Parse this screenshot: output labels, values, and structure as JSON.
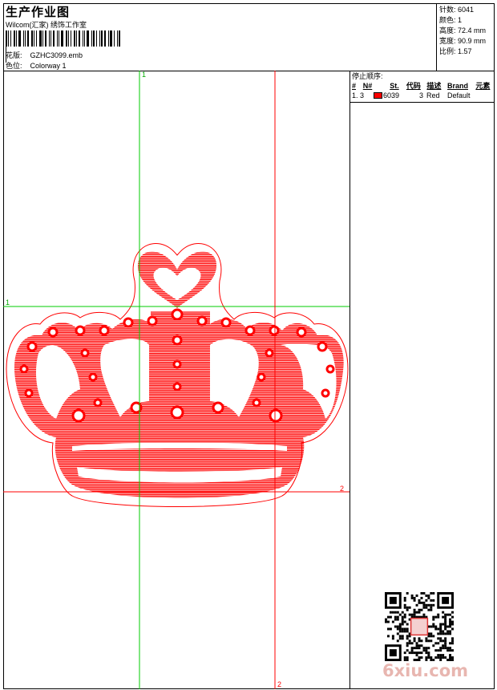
{
  "header": {
    "title": "生产作业图",
    "subtitle": "Wilcom(汇家) 绣饰工作室",
    "design_label": "花版:",
    "design_value": "GZHC3099.emb",
    "colorway_label": "色位:",
    "colorway_value": "Colorway 1"
  },
  "stats": [
    {
      "label": "针数:",
      "value": "6041"
    },
    {
      "label": "颜色:",
      "value": "1"
    },
    {
      "label": "高度:",
      "value": "72.4 mm"
    },
    {
      "label": "宽度:",
      "value": "90.9 mm"
    },
    {
      "label": "比例:",
      "value": "1.57"
    }
  ],
  "stop_sequence": {
    "title": "停止顺序:",
    "columns": [
      "#",
      "N#",
      "St.",
      "代码",
      "描述",
      "Brand",
      "元素"
    ],
    "rows": [
      {
        "index": "1.",
        "needle": "3",
        "code": "6039",
        "stitches": "3",
        "description": "Red",
        "brand": "Default",
        "color": "#ff0000"
      }
    ]
  },
  "guides": {
    "label_top": "1",
    "label_left": "1",
    "label_right": "2",
    "label_bottom": "2"
  },
  "design_color": "#ff0000",
  "watermark": "6xiu.com"
}
